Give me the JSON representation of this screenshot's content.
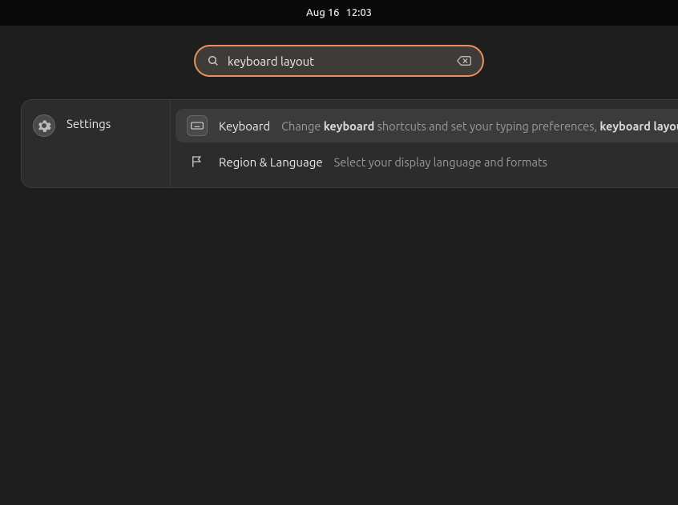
{
  "topbar": {
    "date": "Aug 16",
    "time": "12:03"
  },
  "search": {
    "value": "keyboard layout",
    "placeholder": ""
  },
  "panel": {
    "category": "Settings"
  },
  "results": {
    "keyboard": {
      "title": "Keyboard",
      "desc_pre": "Change ",
      "desc_b1": "keyboard",
      "desc_mid": " shortcuts and set your typing preferences, ",
      "desc_b2": "keyboard layout"
    },
    "region": {
      "title": "Region & Language",
      "desc": "Select your display language and formats"
    }
  }
}
